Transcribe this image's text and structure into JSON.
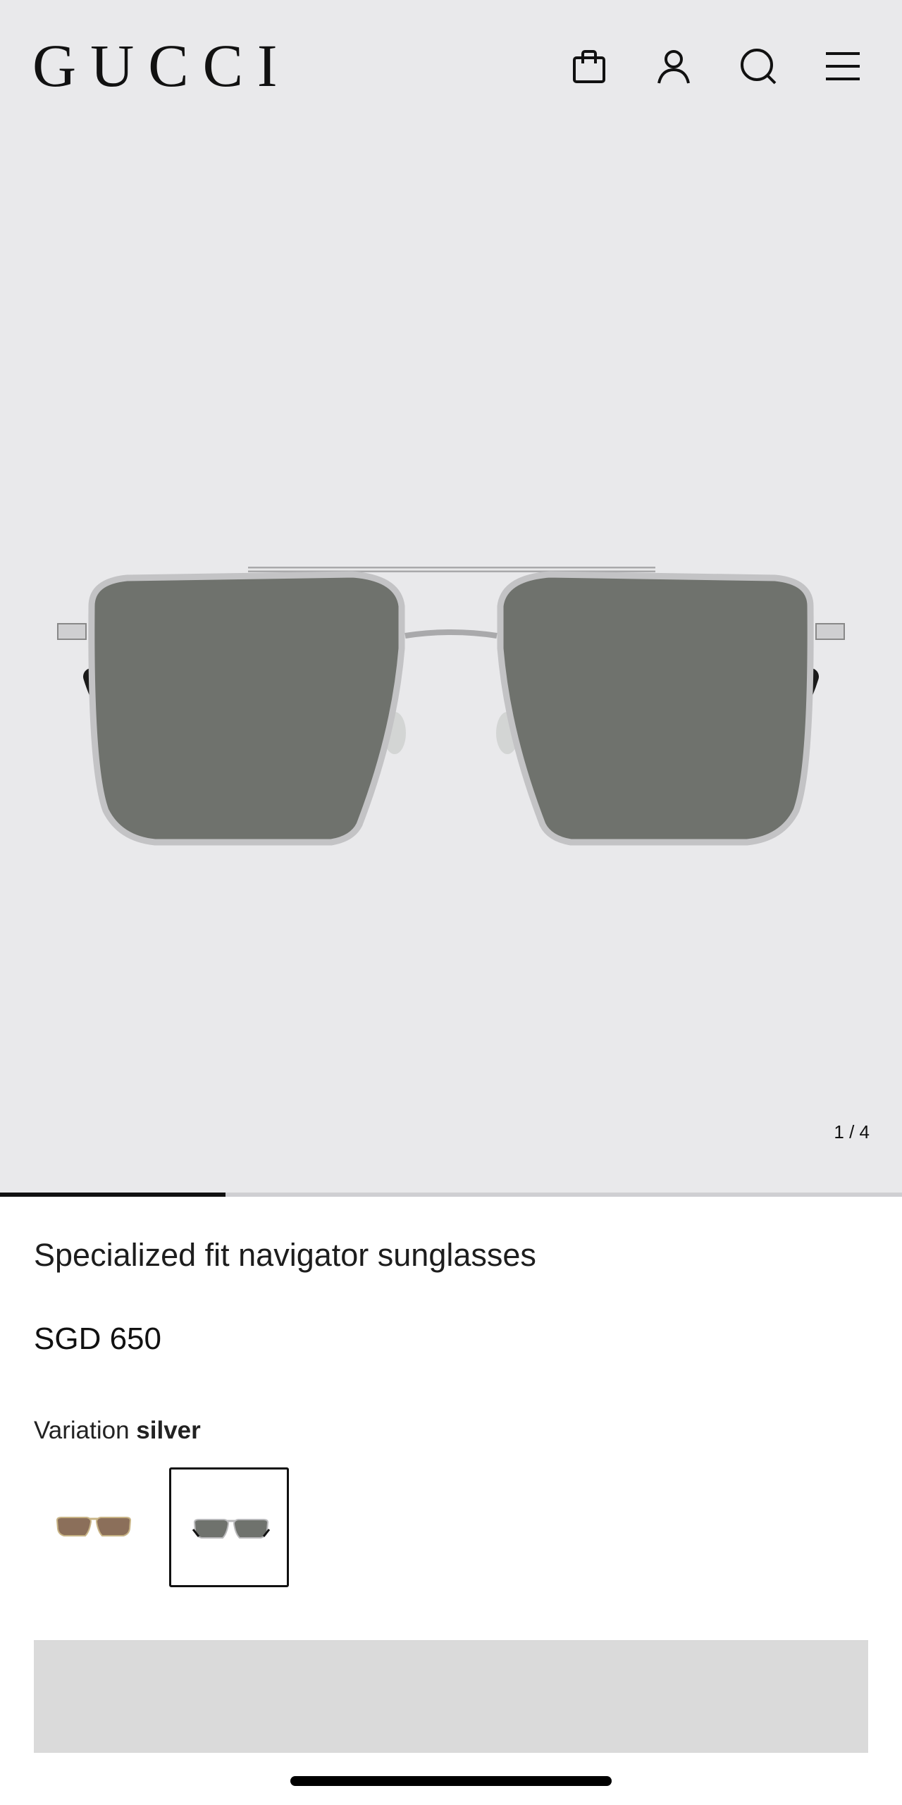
{
  "header": {
    "logo": "GUCCI",
    "icons": [
      "shopping-bag-icon",
      "account-icon",
      "search-icon",
      "menu-icon"
    ]
  },
  "gallery": {
    "counter": "1 / 4",
    "current_image": 1,
    "total_images": 4,
    "progress_fraction": 0.25
  },
  "product": {
    "title": "Specialized fit navigator sunglasses",
    "price": "SGD 650",
    "variation_label": "Variation",
    "variation_value": "silver",
    "variations": [
      {
        "name": "gold-brown",
        "lens_color": "#8b6f5a",
        "frame_color": "#c8b486",
        "selected": false
      },
      {
        "name": "silver",
        "lens_color": "#6f726d",
        "frame_color": "#b9b9bb",
        "selected": true
      }
    ]
  },
  "cta": {
    "label": ""
  },
  "colors": {
    "background": "#e9e9eb",
    "text": "#111111",
    "button": "#dadada"
  }
}
